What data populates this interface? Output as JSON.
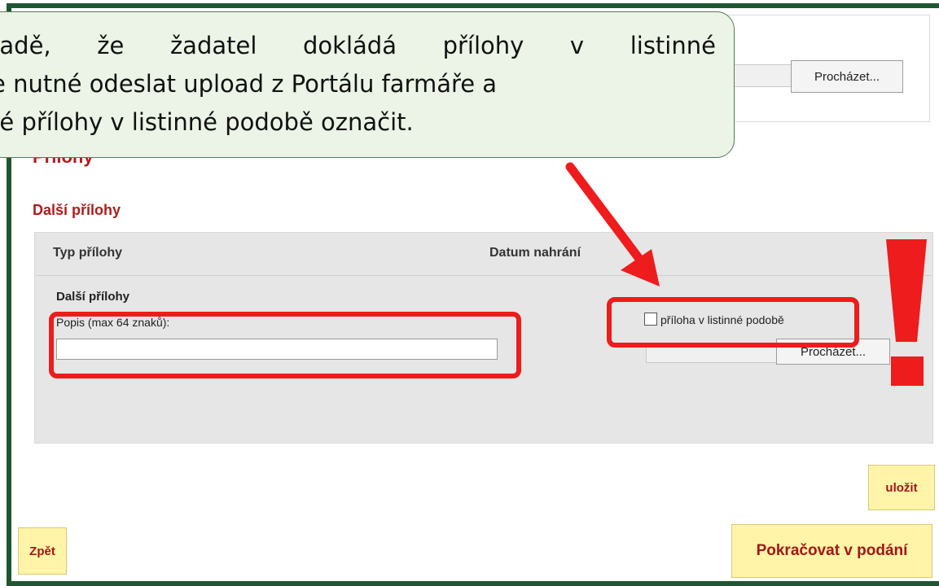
{
  "top": {
    "browse_label": "Procházet..."
  },
  "callout": {
    "line1_words": [
      "padě,",
      "že",
      "žadatel",
      "dokládá",
      "přílohy",
      "v",
      "listinné"
    ],
    "line2": "je nutné odeslat upload z Portálu farmáře a",
    "line3": "né přílohy v listinné podobě označit."
  },
  "section": {
    "title": "Přílohy",
    "subtitle": "Další přílohy"
  },
  "table": {
    "headers": [
      "Typ přílohy",
      "Datum nahrání"
    ],
    "row": {
      "name": "Další přílohy",
      "description_label": "Popis (max 64 znaků):",
      "description_value": "",
      "paper_checkbox_label": "příloha v listinné podobě",
      "paper_checked": false,
      "browse_label": "Procházet..."
    }
  },
  "buttons": {
    "save": "uložit",
    "back": "Zpět",
    "continue": "Pokračovat v podání"
  },
  "colors": {
    "frame": "#1e5631",
    "highlight": "#ee1c1c",
    "button_bg": "#fff4a8",
    "title": "#b01c1c",
    "callout_bg": "#ebf4e6"
  },
  "icons": {
    "warning": "exclamation-icon",
    "arrow": "arrow-icon"
  }
}
